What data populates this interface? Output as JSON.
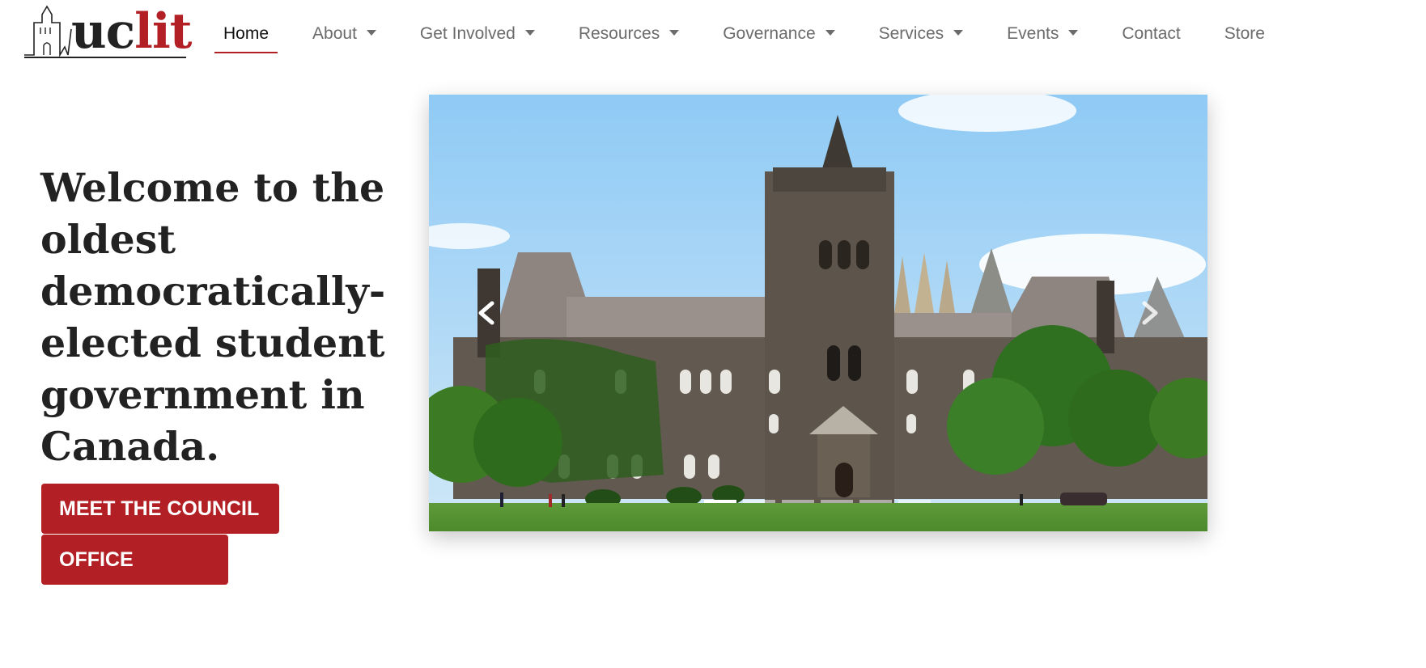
{
  "header": {
    "logo": {
      "text_part1": "uc",
      "text_part2": "lit",
      "accent_color": "#b21f24"
    },
    "nav": [
      {
        "label": "Home",
        "active": true,
        "dropdown": false
      },
      {
        "label": "About",
        "active": false,
        "dropdown": true
      },
      {
        "label": "Get Involved",
        "active": false,
        "dropdown": true
      },
      {
        "label": "Resources",
        "active": false,
        "dropdown": true
      },
      {
        "label": "Governance",
        "active": false,
        "dropdown": true
      },
      {
        "label": "Services",
        "active": false,
        "dropdown": true
      },
      {
        "label": "Events",
        "active": false,
        "dropdown": true
      },
      {
        "label": "Contact",
        "active": false,
        "dropdown": false
      },
      {
        "label": "Store",
        "active": false,
        "dropdown": false
      }
    ]
  },
  "hero": {
    "title": "Welcome to the oldest democratically-elected student government in Canada.",
    "buttons": {
      "council": "MEET THE COUNCIL",
      "hours": "OFFICE HOURS"
    },
    "button_color": "#b21f24"
  },
  "carousel": {
    "prev_icon": "chevron-left-icon",
    "next_icon": "chevron-right-icon",
    "slide_count": 6,
    "active_index": 0
  }
}
